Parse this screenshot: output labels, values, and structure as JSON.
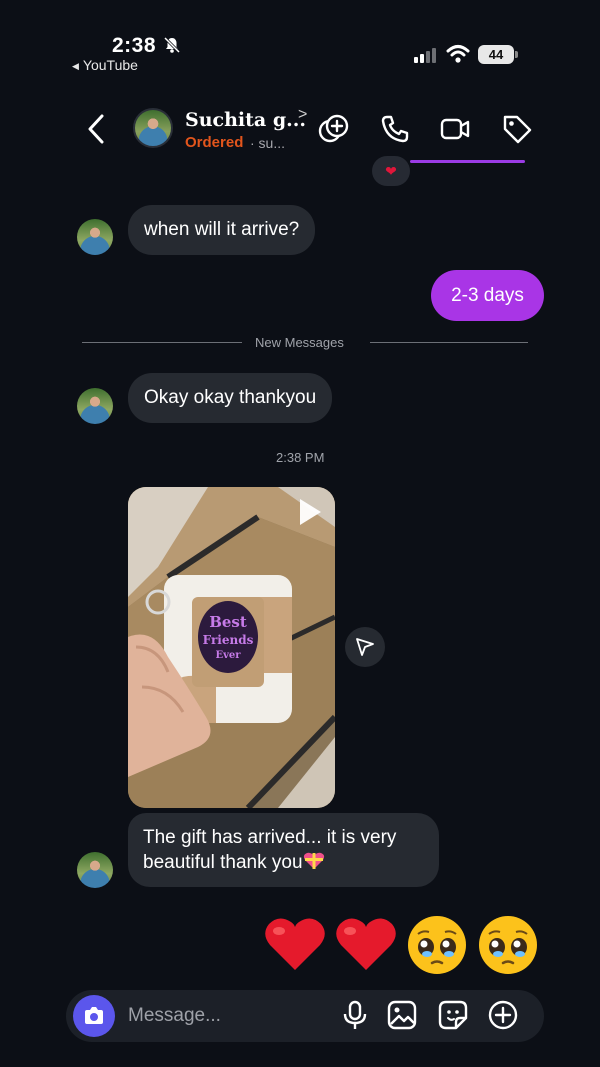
{
  "status_bar": {
    "time": "2:38",
    "back_app": "YouTube",
    "battery": "44"
  },
  "header": {
    "contact_name": "Suchita g...",
    "order_status": "Ordered",
    "subtext": "· su..."
  },
  "messages": {
    "m1": "when will it arrive?",
    "m2": "2-3 days",
    "divider": "New Messages",
    "m3": "Okay okay thankyou",
    "timestamp": "2:38 PM",
    "m5": "The gift has arrived... it is very beautiful thank you"
  },
  "reactions": [
    "red-heart",
    "red-heart",
    "pleading-face",
    "pleading-face"
  ],
  "composer": {
    "placeholder": "Message..."
  },
  "colors": {
    "background": "#0c0f16",
    "incoming_bubble": "#262a31",
    "outgoing_bubble": "#a935e6",
    "order_status": "#e2551c",
    "camera_button": "#5b56ec"
  }
}
